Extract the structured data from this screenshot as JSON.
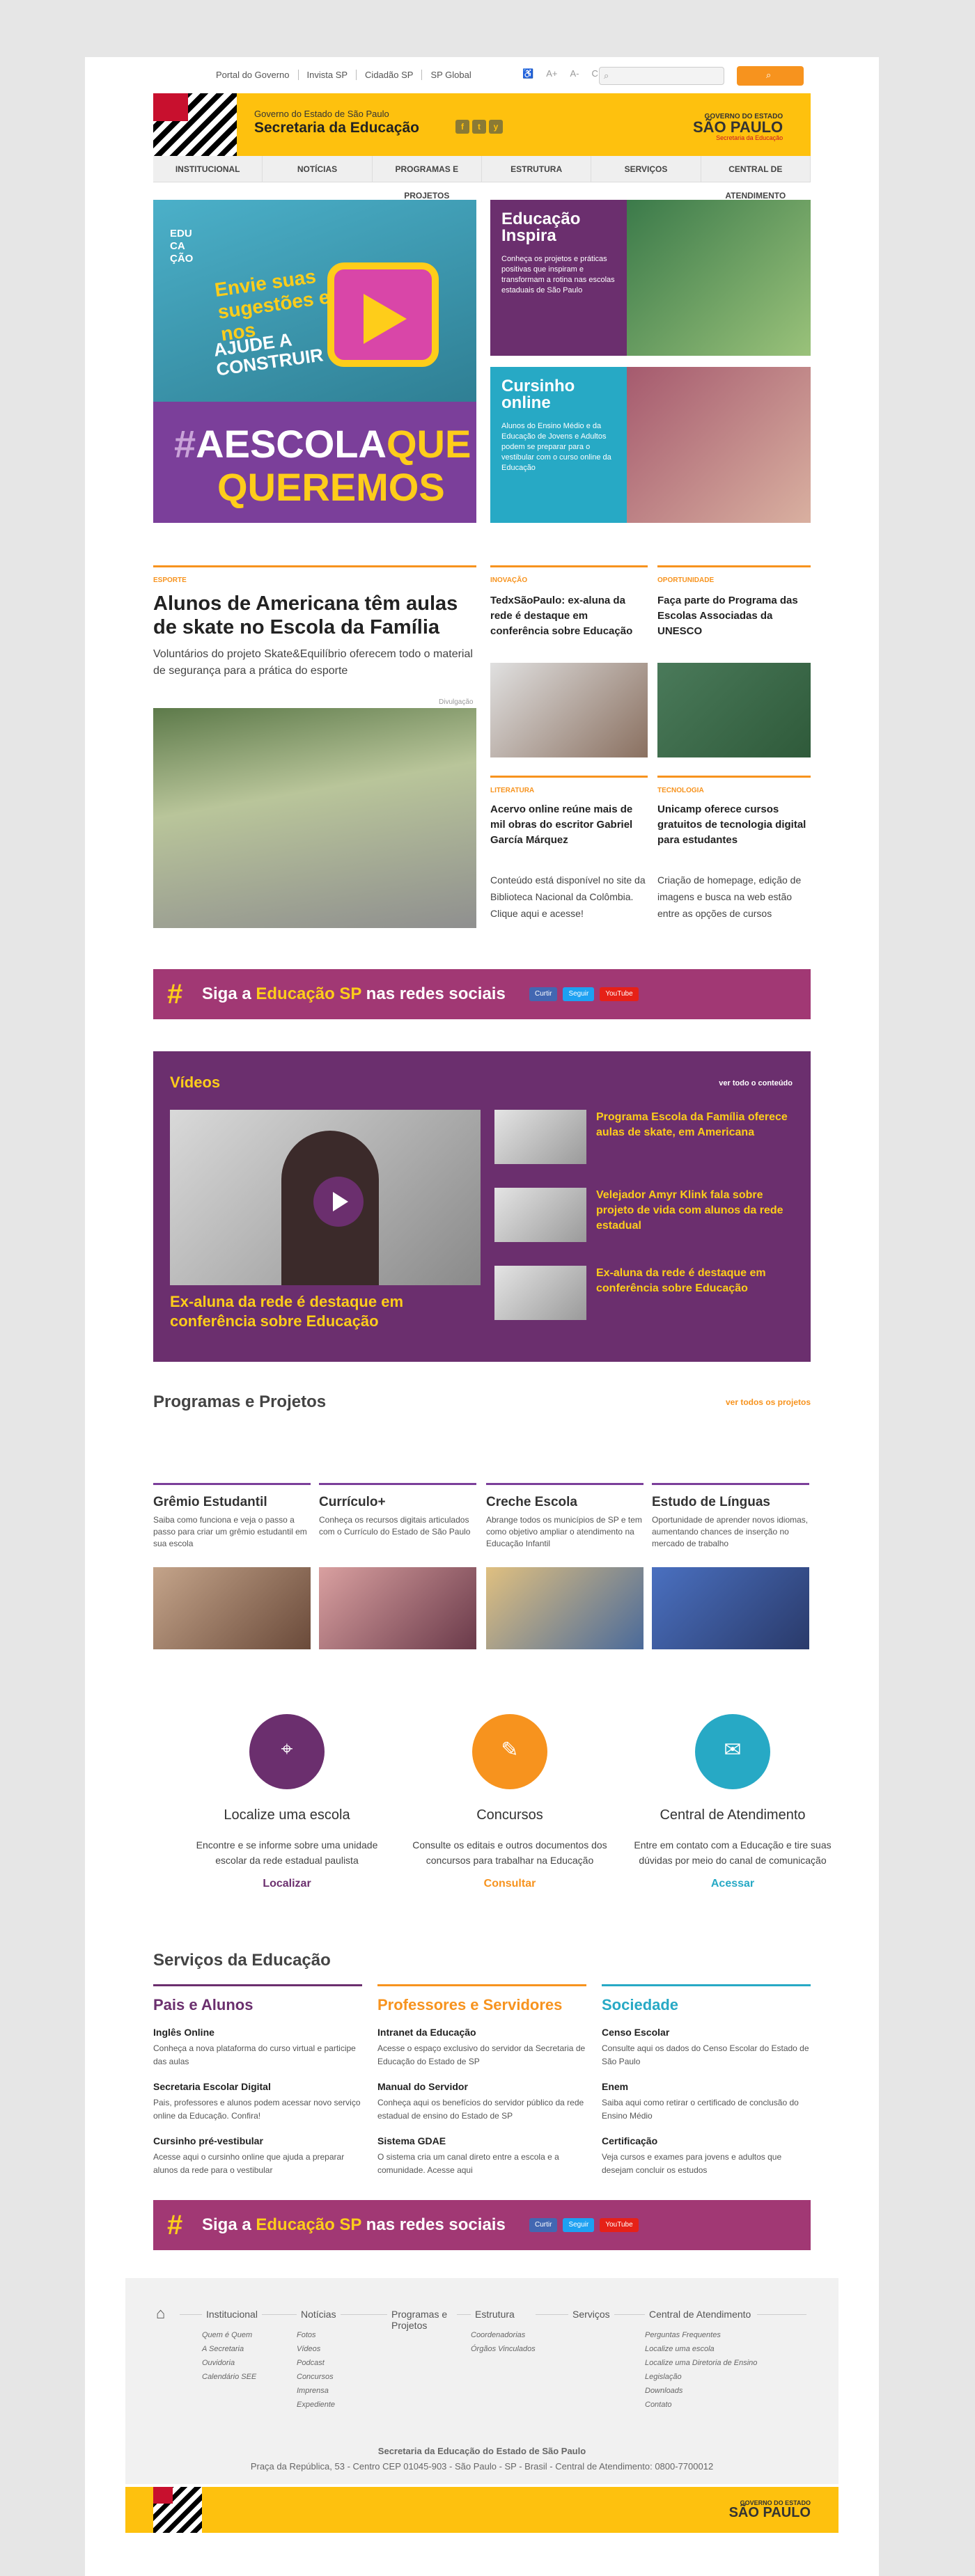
{
  "toplinks": [
    "Portal do Governo",
    "Invista SP",
    "Cidadão SP",
    "SP Global"
  ],
  "accessibility": [
    "A+",
    "A-",
    "C"
  ],
  "search": {
    "placeholder": "",
    "button": ""
  },
  "header": {
    "gov": "Governo do Estado de São Paulo",
    "title": "Secretaria da Educação",
    "social": [
      "f",
      "t",
      "y"
    ],
    "logo_top": "GOVERNO DO ESTADO",
    "logo_main": "SÃO PAULO",
    "logo_sub": "Secretaria da Educação"
  },
  "nav": [
    "INSTITUCIONAL",
    "NOTÍCIAS",
    "PROGRAMAS E PROJETOS",
    "ESTRUTURA",
    "SERVIÇOS",
    "CENTRAL DE ATENDIMENTO"
  ],
  "hero": {
    "edu": "EDU\nCA\nÇÃO",
    "envie": "Envie suas sugestões e nos",
    "ajude": "AJUDE A CONSTRUIR",
    "hashtag": "#",
    "escola1": "AESCOLA",
    "escola2": "QUE",
    "escola3": "QUEREMOS"
  },
  "cards": [
    {
      "title": "Educação Inspira",
      "desc": "Conheça os projetos e práticas positivas que inspiram e transformam a rotina nas escolas estaduais de São Paulo",
      "color": "#6b2f6e"
    },
    {
      "title": "Cursinho online",
      "desc": "Alunos do Ensino Médio e da Educação de Jovens e Adultos podem se preparar para o vestibular com o curso online da Educação",
      "color": "#27a9c5"
    }
  ],
  "main_news": {
    "tag": "ESPORTE",
    "title": "Alunos de Americana têm aulas de skate no Escola da Família",
    "desc": "Voluntários do projeto Skate&Equilíbrio oferecem todo o material de segurança para a prática do esporte",
    "credit": "Divulgação"
  },
  "news": [
    {
      "tag": "INOVAÇÃO",
      "title": "TedxSãoPaulo: ex-aluna da rede é destaque em conferência sobre Educação"
    },
    {
      "tag": "OPORTUNIDADE",
      "title": "Faça parte do Programa das Escolas Associadas da UNESCO"
    },
    {
      "tag": "LITERATURA",
      "title": "Acervo online reúne mais de mil obras do escritor Gabriel García Márquez",
      "desc": "Conteúdo está disponível no site da Biblioteca Nacional da Colômbia. Clique aqui e acesse!"
    },
    {
      "tag": "TECNOLOGIA",
      "title": "Unicamp oferece cursos gratuitos de tecnologia digital para estudantes",
      "desc": "Criação de homepage, edição de imagens e busca na web estão entre as opções de cursos"
    }
  ],
  "banner": {
    "hash": "#",
    "pre": "Siga a ",
    "mid": "Educação SP",
    "post": " nas redes sociais",
    "buttons": [
      "Curtir",
      "Seguir",
      "YouTube"
    ]
  },
  "videos": {
    "title": "Vídeos",
    "all": "ver todo o conteúdo",
    "main_caption": "Ex-aluna da rede é destaque em conferência sobre Educação",
    "items": [
      "Programa Escola da Família oferece aulas de skate, em Americana",
      "Velejador Amyr Klink fala sobre projeto de vida com alunos da rede estadual",
      "Ex-aluna da rede é destaque em conferência sobre Educação"
    ]
  },
  "programs": {
    "title": "Programas e Projetos",
    "all": "ver todos os projetos",
    "items": [
      {
        "title": "Grêmio Estudantil",
        "desc": "Saiba como funciona e veja o passo a passo para criar um grêmio estudantil em sua escola"
      },
      {
        "title": "Currículo+",
        "desc": "Conheça os recursos digitais articulados com o Currículo do Estado de São Paulo"
      },
      {
        "title": "Creche Escola",
        "desc": "Abrange todos os municípios de SP e tem como objetivo ampliar o atendimento na Educação Infantil"
      },
      {
        "title": "Estudo de Línguas",
        "desc": "Oportunidade de aprender novos idiomas, aumentando chances de inserção no mercado de trabalho"
      }
    ]
  },
  "services_icons": [
    {
      "title": "Localize uma escola",
      "desc": "Encontre e se informe sobre uma unidade escolar da rede estadual paulista",
      "link": "Localizar",
      "color": "#6b2f6e",
      "icon": "⌖"
    },
    {
      "title": "Concursos",
      "desc": "Consulte os editais e outros documentos dos concursos para trabalhar na Educação",
      "link": "Consultar",
      "color": "#f7931e",
      "icon": "✎"
    },
    {
      "title": "Central de Atendimento",
      "desc": "Entre em contato com a Educação e tire suas dúvidas por meio do canal de comunicação",
      "link": "Acessar",
      "color": "#27a9c5",
      "icon": "✉"
    }
  ],
  "services": {
    "title": "Serviços da Educação",
    "columns": [
      {
        "heading": "Pais e Alunos",
        "color": "#6b2f6e",
        "items": [
          {
            "title": "Inglês Online",
            "desc": "Conheça a nova plataforma do curso virtual e participe das aulas"
          },
          {
            "title": "Secretaria Escolar Digital",
            "desc": "Pais, professores e alunos podem acessar novo serviço online da Educação. Confira!"
          },
          {
            "title": "Cursinho pré-vestibular",
            "desc": "Acesse aqui o cursinho online que ajuda a preparar alunos da rede para o vestibular"
          }
        ]
      },
      {
        "heading": "Professores e Servidores",
        "color": "#f7931e",
        "items": [
          {
            "title": "Intranet da Educação",
            "desc": "Acesse o espaço exclusivo do servidor da Secretaria de Educação do Estado de SP"
          },
          {
            "title": "Manual do Servidor",
            "desc": "Conheça aqui os benefícios do servidor público da rede estadual de ensino do Estado de SP"
          },
          {
            "title": "Sistema GDAE",
            "desc": "O sistema cria um canal direto entre a escola e a comunidade. Acesse aqui"
          }
        ]
      },
      {
        "heading": "Sociedade",
        "color": "#27a9c5",
        "items": [
          {
            "title": "Censo Escolar",
            "desc": "Consulte aqui os dados do Censo Escolar do Estado de São Paulo"
          },
          {
            "title": "Enem",
            "desc": "Saiba aqui como retirar o certificado de conclusão do Ensino Médio"
          },
          {
            "title": "Certificação",
            "desc": "Veja cursos e exames para jovens e adultos que desejam concluir os estudos"
          }
        ]
      }
    ]
  },
  "footer": {
    "columns": [
      {
        "h": "Institucional",
        "items": [
          "Quem é Quem",
          "A Secretaria",
          "Ouvidoria",
          "Calendário SEE"
        ]
      },
      {
        "h": "Notícias",
        "items": [
          "Fotos",
          "Vídeos",
          "Podcast",
          "Concursos",
          "Imprensa",
          "Expediente"
        ]
      },
      {
        "h": "Programas e Projetos",
        "items": []
      },
      {
        "h": "Estrutura",
        "items": [
          "Coordenadorias",
          "Órgãos Vinculados"
        ]
      },
      {
        "h": "Serviços",
        "items": []
      },
      {
        "h": "Central de Atendimento",
        "items": [
          "Perguntas Frequentes",
          "Localize uma escola",
          "Localize uma Diretoria de Ensino",
          "Legislação",
          "Downloads",
          "Contato"
        ]
      }
    ],
    "org": "Secretaria da Educação do Estado de São Paulo",
    "address": "Praça da República, 53 - Centro CEP 01045-903 - São Paulo - SP - Brasil - Central de Atendimento: 0800-7700012",
    "logo_top": "GOVERNO DO ESTADO",
    "logo_main": "SÃO PAULO"
  }
}
